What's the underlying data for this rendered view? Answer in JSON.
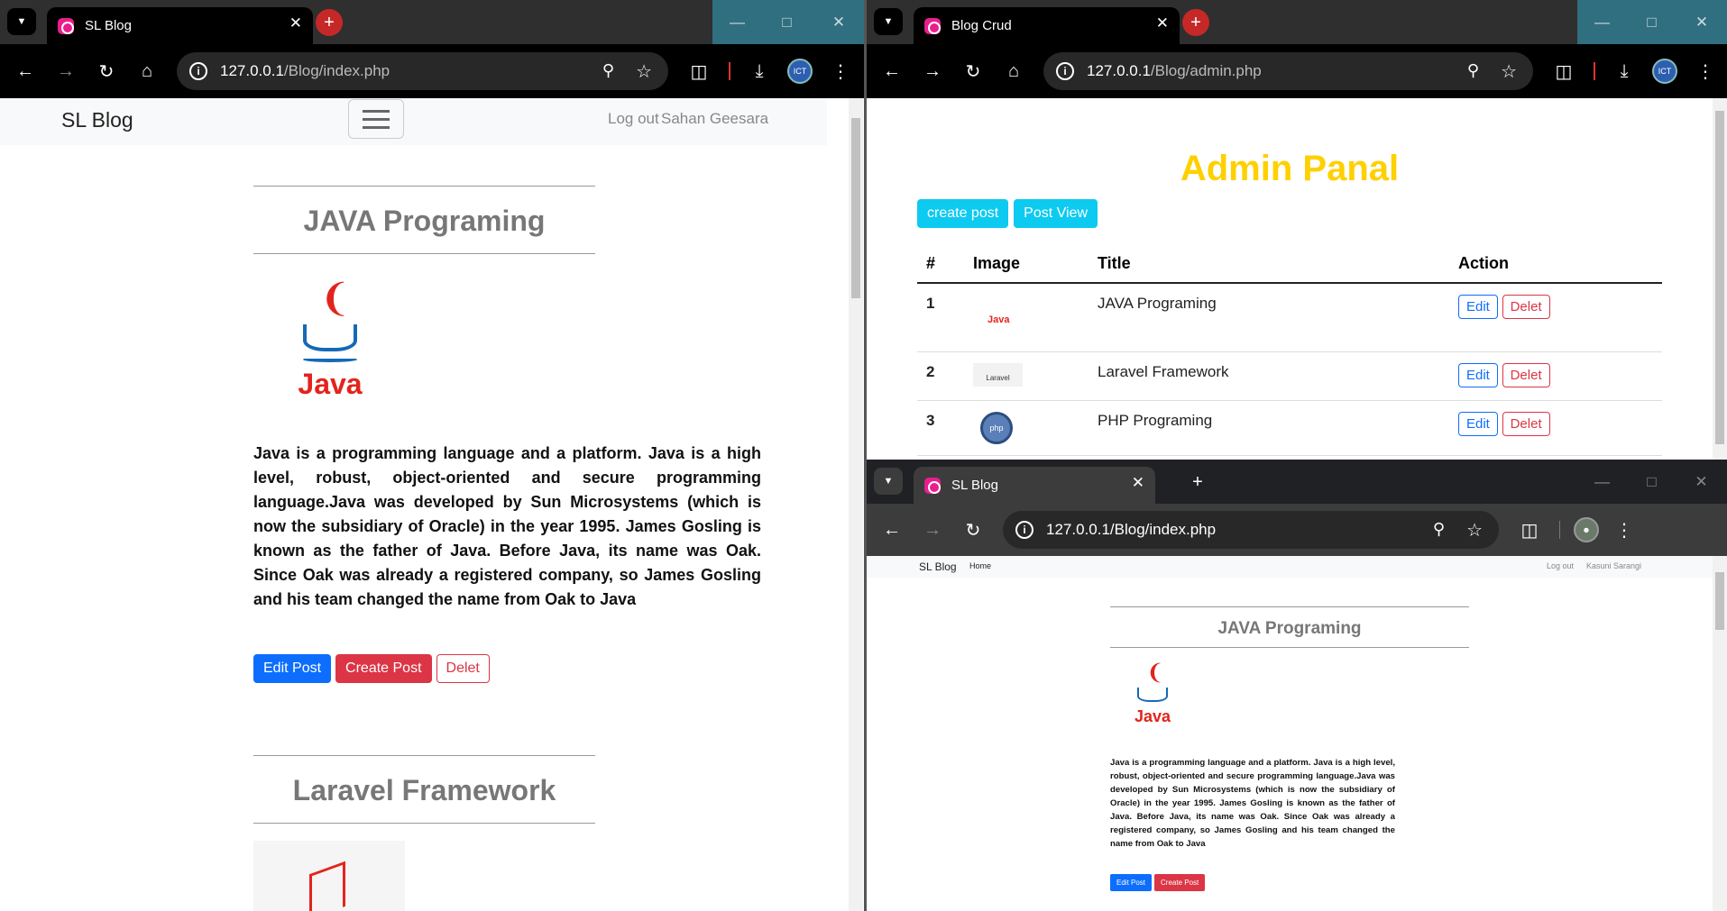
{
  "left_window": {
    "tab_title": "SL Blog",
    "url_host": "127.0.0.1",
    "url_path": "/Blog/index.php",
    "navbar": {
      "brand": "SL Blog",
      "logout": "Log out",
      "user": "Sahan Geesara"
    },
    "posts": [
      {
        "title": "JAVA Programing",
        "body": "Java is a programming language and a platform. Java is a high level, robust, object-oriented and secure programming language.Java was developed by Sun Microsystems (which is now the subsidiary of Oracle) in the year 1995. James Gosling is known as the father of Java. Before Java, its name was Oak. Since Oak was already a registered company, so James Gosling and his team changed the name from Oak to Java",
        "logo_text": "Java"
      },
      {
        "title": "Laravel Framework"
      }
    ],
    "buttons": {
      "edit": "Edit Post",
      "create": "Create Post",
      "delete": "Delet"
    }
  },
  "right_top_window": {
    "tab_title": "Blog Crud",
    "url_host": "127.0.0.1",
    "url_path": "/Blog/admin.php",
    "heading": "Admin Panal",
    "buttons": {
      "create": "create post",
      "view": "Post View"
    },
    "table": {
      "headers": [
        "#",
        "Image",
        "Title",
        "Action"
      ],
      "rows": [
        {
          "num": "1",
          "title": "JAVA Programing",
          "thumb": "Java"
        },
        {
          "num": "2",
          "title": "Laravel Framework",
          "thumb": "Laravel"
        },
        {
          "num": "3",
          "title": "PHP Programing",
          "thumb": "php"
        }
      ],
      "edit": "Edit",
      "delete": "Delet"
    }
  },
  "right_bottom_window": {
    "tab_title": "SL Blog",
    "url": "127.0.0.1/Blog/index.php",
    "navbar": {
      "brand": "SL Blog",
      "home": "Home",
      "logout": "Log out",
      "user": "Kasuni Sarangi"
    },
    "post_title": "JAVA Programing",
    "logo_text": "Java",
    "buttons": {
      "edit": "Edit Post",
      "create": "Create Post"
    }
  },
  "colors": {
    "accent_yellow": "#ffd000",
    "primary": "#0d6efd",
    "danger": "#dc3545",
    "info": "#0dcaf0"
  }
}
